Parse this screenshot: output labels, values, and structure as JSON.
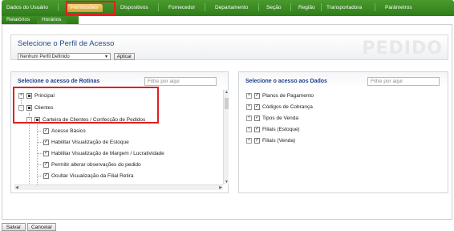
{
  "tabs": {
    "row1": [
      "Dados do Usuário",
      "Permissões",
      "Dispositivos",
      "Fornecedor",
      "Departamento",
      "Seção",
      "Região",
      "Transportadora",
      "Parâmetros"
    ],
    "row2": [
      "Relatórios",
      "Horários"
    ],
    "active": "Permissões"
  },
  "profile": {
    "title": "Selecione o Perfil de Acesso",
    "select_value": "Nenhum Perfil Definido",
    "apply_label": "Aplicar",
    "watermark": "PEDIDO"
  },
  "routines": {
    "title": "Selecione o acesso de Rotinas",
    "filter_placeholder": "Filtre por aqui",
    "items": [
      {
        "label": "Principal",
        "expander": "+",
        "state": "full"
      },
      {
        "label": "Clientes",
        "expander": "-",
        "state": "full"
      },
      {
        "label": "Carteira de Clientes / Confecção de Pedidos",
        "expander": "-",
        "state": "full"
      },
      {
        "label": "Acesso Básico",
        "state": "check"
      },
      {
        "label": "Habilitar Visualização de Estoque",
        "state": "check"
      },
      {
        "label": "Habilitar Visualização de Margem / Lucratividade",
        "state": "check"
      },
      {
        "label": "Permitir alterar observações do pedido",
        "state": "check"
      },
      {
        "label": "Ocultar Visualização da Filial Retira",
        "state": "check"
      }
    ]
  },
  "data_access": {
    "title": "Selecione o acesso aos Dados",
    "filter_placeholder": "Filtre por aqui",
    "items": [
      {
        "label": "Planos de Pagamento",
        "expander": "+",
        "state": "check"
      },
      {
        "label": "Códigos de Cobrança",
        "expander": "+",
        "state": "check"
      },
      {
        "label": "Tipos de Venda",
        "expander": "+",
        "state": "check"
      },
      {
        "label": "Filiais (Estoque)",
        "expander": "+",
        "state": "check"
      },
      {
        "label": "Filiais (Venda)",
        "expander": "+",
        "state": "check"
      }
    ]
  },
  "footer": {
    "save_label": "Salvar",
    "cancel_label": "Cancelar"
  },
  "colors": {
    "tab_green": "#3a8a22",
    "active_tab": "#e8b84f",
    "highlight": "#e02020",
    "title_blue": "#1d3f8a"
  }
}
